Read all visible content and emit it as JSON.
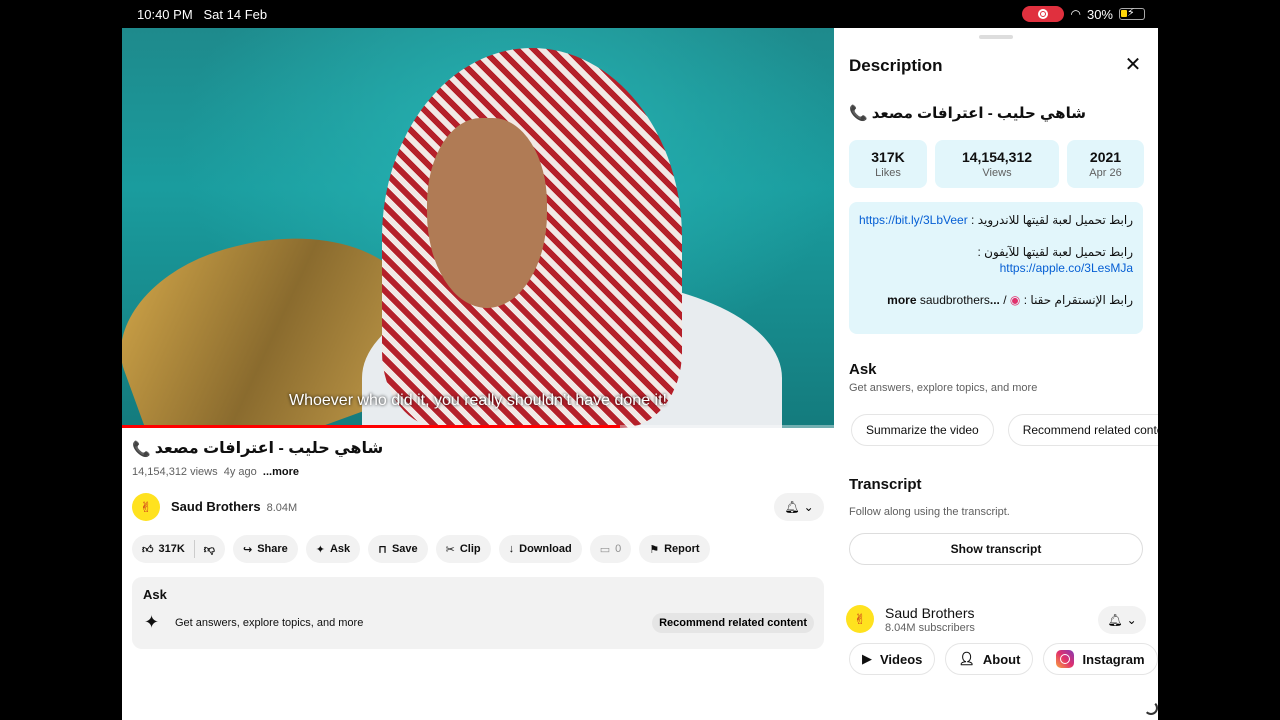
{
  "status": {
    "time": "10:40 PM",
    "date": "Sat 14 Feb",
    "battery": "30%",
    "battery_level": 0.3
  },
  "video": {
    "subtitle": "Whoever who did it, you really shouldn’t have done it!",
    "progress": 0.7,
    "title": "شاهي حليب - اعترافات مصعد",
    "views": "14,154,312 views",
    "age": "4y ago",
    "more": "...more"
  },
  "channel": {
    "name": "Saud Brothers",
    "subs_short": "8.04M",
    "subs_long": "8.04M subscribers"
  },
  "actions": {
    "likes": "317K",
    "share": "Share",
    "ask": "Ask",
    "save": "Save",
    "clip": "Clip",
    "download": "Download",
    "comments": "0",
    "report": "Report"
  },
  "ask_card": {
    "title": "Ask",
    "subtitle": "Get answers, explore topics, and more",
    "chip": "Recommend related content"
  },
  "panel": {
    "title": "Description",
    "video_title": "شاهي حليب - اعترافات مصعد",
    "stats": [
      {
        "value": "317K",
        "label": "Likes"
      },
      {
        "value": "14,154,312",
        "label": "Views"
      },
      {
        "value": "2021",
        "label": "Apr 26"
      }
    ],
    "desc": {
      "line1_text": "رابط تحميل لعبة لقيتها للاندرويد : ",
      "line1_link": "https://bit.ly/3LbVeer",
      "line2_text": "رابط تحميل لعبة لقيتها للآيفون : ",
      "line2_link": "https://apple.co/3LesMJa",
      "line3_text": "رابط الإنستقرام حقنا : ",
      "line3_handle": "saudbrothers",
      "more": "...more"
    },
    "ask": {
      "title": "Ask",
      "subtitle": "Get answers, explore topics, and more",
      "chips": [
        "Summarize the video",
        "Recommend related content"
      ]
    },
    "transcript": {
      "title": "Transcript",
      "subtitle": "Follow along using the transcript.",
      "button": "Show transcript"
    },
    "links": {
      "videos": "Videos",
      "about": "About",
      "instagram": "Instagram"
    }
  }
}
